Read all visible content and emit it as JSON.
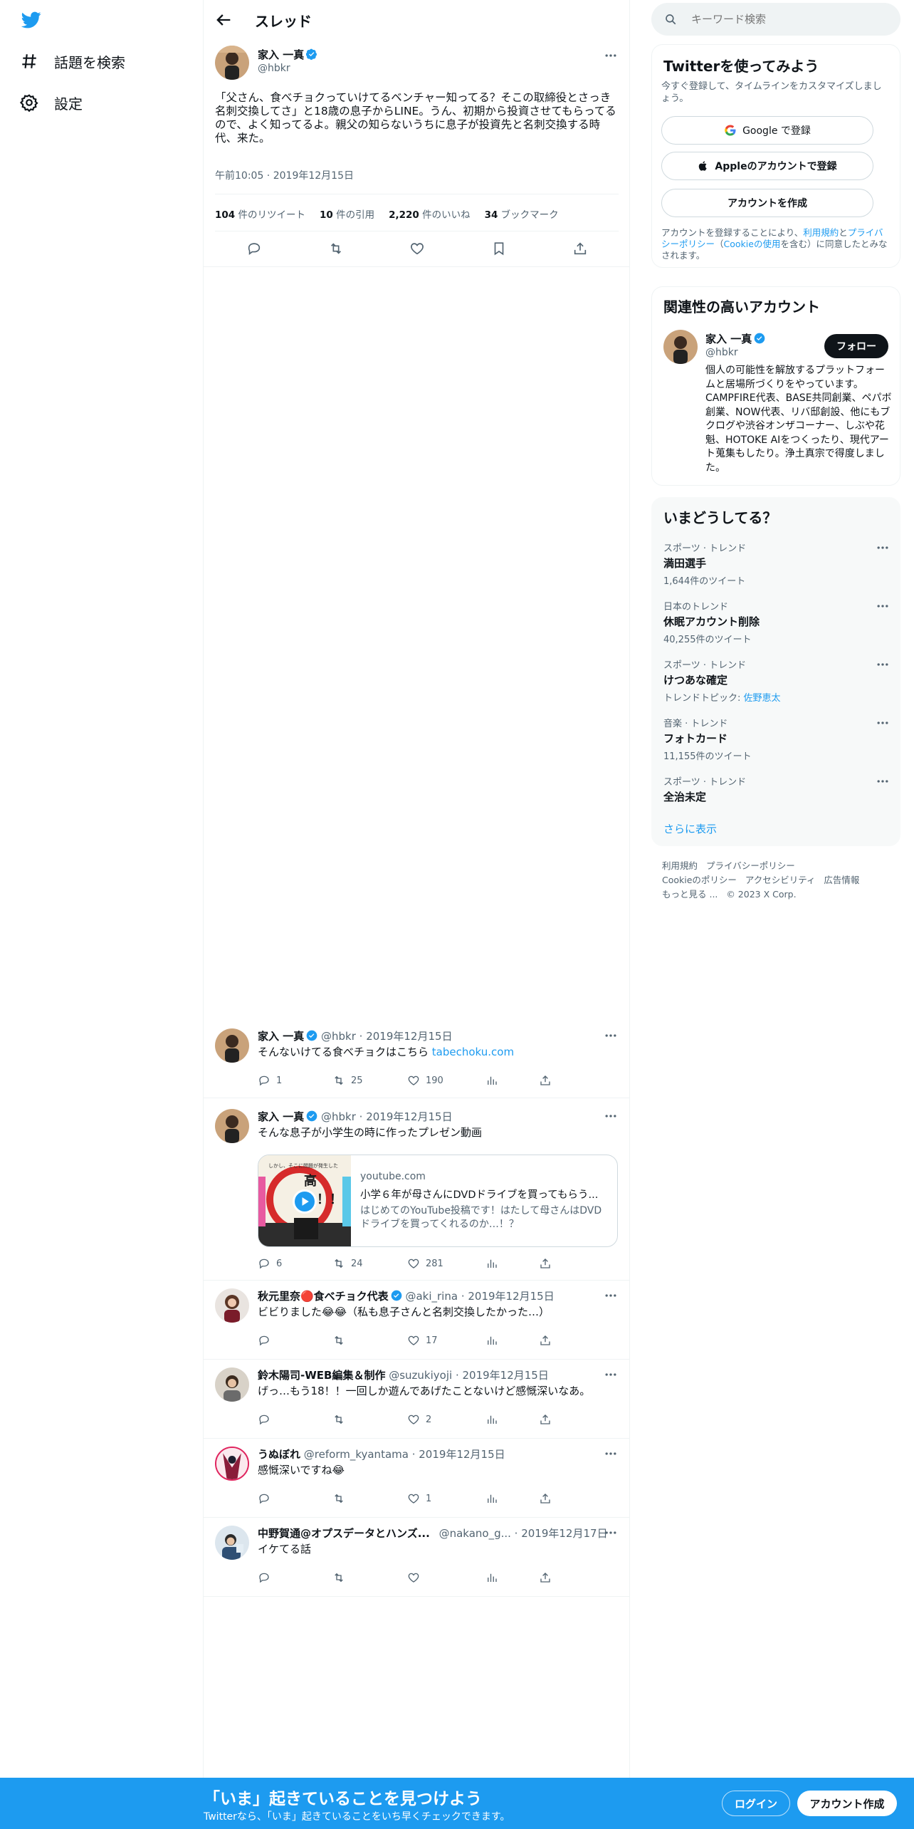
{
  "nav": {
    "explore_label": "話題を検索",
    "settings_label": "設定"
  },
  "header": {
    "title": "スレッド"
  },
  "main_tweet": {
    "name": "家入 一真",
    "handle": "@hbkr",
    "text": "「父さん、食べチョクっていけてるベンチャー知ってる？そこの取締役とさっき名刺交換してさ」と18歳の息子からLINE。うん、初期から投資させてもらってるので、よく知ってるよ。親父の知らないうちに息子が投資先と名刺交換する時代、来た。",
    "time": "午前10:05",
    "date": "2019年12月15日",
    "stats": {
      "retweets_count": "104",
      "retweets_label": "件のリツイート",
      "quotes_count": "10",
      "quotes_label": "件の引用",
      "likes_count": "2,220",
      "likes_label": "件のいいね",
      "bookmarks_count": "34",
      "bookmarks_label": "ブックマーク"
    }
  },
  "replies": [
    {
      "name": "家入 一真",
      "handle": "@hbkr",
      "date": "2019年12月15日",
      "text": "そんないけてる食べチョクはこちら",
      "link_text": "tabechoku.com",
      "replies": "1",
      "retweets": "25",
      "likes": "190"
    },
    {
      "name": "家入 一真",
      "handle": "@hbkr",
      "date": "2019年12月15日",
      "text": "そんな息子が小学生の時に作ったプレゼン動画",
      "card": {
        "domain": "youtube.com",
        "title": "小学６年が母さんにDVDドライブを買ってもらう...",
        "description": "はじめてのYouTube投稿です！はたして母さんはDVDドライブを買ってくれるのか…！？",
        "thumb_text_top": "しかし、そこに問題が発生した",
        "thumb_text_main": "高い！！"
      },
      "replies": "6",
      "retweets": "24",
      "likes": "281"
    },
    {
      "name": "秋元里奈🔴食べチョク代表",
      "handle": "@aki_rina",
      "date": "2019年12月15日",
      "text": "ビビりました😂😂（私も息子さんと名刺交換したかった…）",
      "replies": "",
      "retweets": "",
      "likes": "17"
    },
    {
      "name": "鈴木陽司-WEB編集＆制作",
      "handle": "@suzukiyoji",
      "date": "2019年12月15日",
      "text": "げっ…もう18！！一回しか遊んであげたことないけど感慨深いなあ。",
      "replies": "",
      "retweets": "",
      "likes": "2"
    },
    {
      "name": "うぬぼれ",
      "handle": "@reform_kyantama",
      "date": "2019年12月15日",
      "text": "感慨深いですね😂",
      "replies": "",
      "retweets": "",
      "likes": "1"
    },
    {
      "name": "中野賀通@オプスデータとハンズ...",
      "handle": "@nakano_g...",
      "date": "2019年12月17日",
      "text": "イケてる話",
      "replies": "",
      "retweets": "",
      "likes": ""
    }
  ],
  "search": {
    "placeholder": "キーワード検索"
  },
  "signup_card": {
    "title": "Twitterを使ってみよう",
    "subtitle": "今すぐ登録して、タイムラインをカスタマイズしましょう。",
    "google_label": "Google で登録",
    "apple_label": "Appleのアカウントで登録",
    "create_label": "アカウントを作成",
    "terms_prefix": "アカウントを登録することにより、",
    "terms_link": "利用規約",
    "and": "と",
    "privacy_link": "プライバシーポリシー",
    "cookie_open": "（",
    "cookie_link": "Cookieの使用",
    "terms_suffix": "を含む）に同意したとみなされます。"
  },
  "relevant_card": {
    "title": "関連性の高いアカウント",
    "name": "家入 一真",
    "handle": "@hbkr",
    "follow_label": "フォロー",
    "bio": "個人の可能性を解放するプラットフォームと居場所づくりをやっています。CAMPFIRE代表、BASE共同創業、ペパボ創業、NOW代表、リバ邸創設、他にもブクログや渋谷オンザコーナー、しぶや花魁、HOTOKE AIをつくったり、現代アート蒐集もしたり。浄土真宗で得度しました。"
  },
  "trends_card": {
    "title": "いまどうしてる？",
    "items": [
      {
        "category": "スポーツ · トレンド",
        "title": "満田選手",
        "meta": "1,644件のツイート",
        "meta_link": ""
      },
      {
        "category": "日本のトレンド",
        "title": "休眠アカウント削除",
        "meta": "40,255件のツイート",
        "meta_link": ""
      },
      {
        "category": "スポーツ · トレンド",
        "title": "けつあな確定",
        "meta": "トレンドトピック: ",
        "meta_link": "佐野恵太"
      },
      {
        "category": "音楽 · トレンド",
        "title": "フォトカード",
        "meta": "11,155件のツイート",
        "meta_link": ""
      },
      {
        "category": "スポーツ · トレンド",
        "title": "全治未定",
        "meta": "",
        "meta_link": ""
      }
    ],
    "show_more": "さらに表示"
  },
  "footer": {
    "terms": "利用規約",
    "privacy": "プライバシーポリシー",
    "cookie": "Cookieのポリシー",
    "accessibility": "アクセシビリティ",
    "ads": "広告情報",
    "more": "もっと見る ...",
    "copyright": "© 2023 X Corp."
  },
  "bottom_bar": {
    "headline": "「いま」起きていることを見つけよう",
    "sub": "Twitterなら、「いま」起きていることをいち早くチェックできます。",
    "login_label": "ログイン",
    "signup_label": "アカウント作成"
  },
  "colors": {
    "brand": "#1d9bf0",
    "text": "#0f1419",
    "muted": "#536471",
    "border": "#eff3f4"
  }
}
